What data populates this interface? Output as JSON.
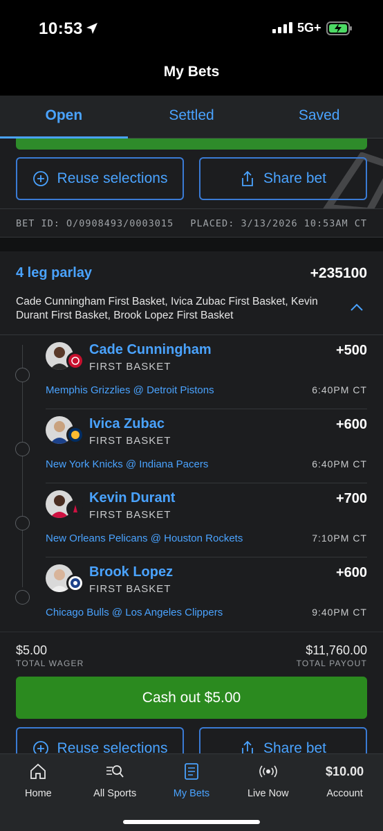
{
  "status": {
    "time": "10:53",
    "network": "5G+"
  },
  "title": "My Bets",
  "tabs": [
    {
      "label": "Open",
      "active": true
    },
    {
      "label": "Settled",
      "active": false
    },
    {
      "label": "Saved",
      "active": false
    }
  ],
  "top_actions": {
    "reuse": "Reuse selections",
    "share": "Share bet"
  },
  "bet_meta": {
    "bet_id": "BET ID: O/0908493/0003015",
    "placed": "PLACED: 3/13/2026 10:53AM CT"
  },
  "parlay": {
    "title": "4 leg parlay",
    "odds": "+235100",
    "description": "Cade Cunningham First Basket, Ivica Zubac First Basket, Kevin Durant First Basket, Brook Lopez First Basket"
  },
  "legs": [
    {
      "player": "Cade Cunningham",
      "market": "FIRST BASKET",
      "odds": "+500",
      "game": "Memphis Grizzlies @ Detroit Pistons",
      "time": "6:40PM CT"
    },
    {
      "player": "Ivica Zubac",
      "market": "FIRST BASKET",
      "odds": "+600",
      "game": "New York Knicks @ Indiana Pacers",
      "time": "6:40PM CT"
    },
    {
      "player": "Kevin Durant",
      "market": "FIRST BASKET",
      "odds": "+700",
      "game": "New Orleans Pelicans @ Houston Rockets",
      "time": "7:10PM CT"
    },
    {
      "player": "Brook Lopez",
      "market": "FIRST BASKET",
      "odds": "+600",
      "game": "Chicago Bulls @ Los Angeles Clippers",
      "time": "9:40PM CT"
    }
  ],
  "totals": {
    "wager": "$5.00",
    "wager_label": "TOTAL WAGER",
    "payout": "$11,760.00",
    "payout_label": "TOTAL PAYOUT"
  },
  "cashout": "Cash out $5.00",
  "bottom_actions": {
    "reuse": "Reuse selections",
    "share": "Share bet"
  },
  "nav": [
    {
      "label": "Home",
      "icon": "home-icon"
    },
    {
      "label": "All Sports",
      "icon": "search-sports-icon"
    },
    {
      "label": "My Bets",
      "icon": "bet-slip-icon",
      "active": true
    },
    {
      "label": "Live Now",
      "icon": "live-broadcast-icon"
    },
    {
      "label": "Account",
      "balance": "$10.00"
    }
  ],
  "colors": {
    "accent": "#4aa3ff",
    "cashout_green": "#2b8a1f",
    "background": "#1c1d1f"
  }
}
